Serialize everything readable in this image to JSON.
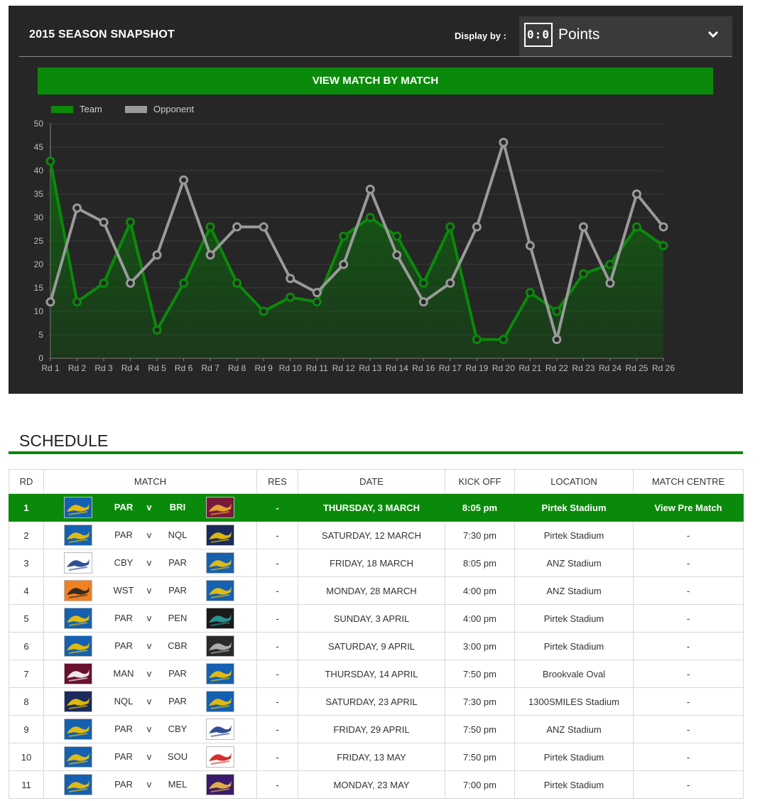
{
  "snapshot": {
    "title": "2015 SEASON SNAPSHOT",
    "display_label": "Display by :",
    "display_icon_text": "0:0",
    "display_value": "Points",
    "view_button": "VIEW MATCH BY MATCH"
  },
  "chart_data": {
    "type": "line",
    "categories": [
      "Rd 1",
      "Rd 2",
      "Rd 3",
      "Rd 4",
      "Rd 5",
      "Rd 6",
      "Rd 7",
      "Rd 8",
      "Rd 9",
      "Rd 10",
      "Rd 11",
      "Rd 12",
      "Rd 13",
      "Rd 14",
      "Rd 16",
      "Rd 17",
      "Rd 19",
      "Rd 20",
      "Rd 21",
      "Rd 22",
      "Rd 23",
      "Rd 24",
      "Rd 25",
      "Rd 26"
    ],
    "series": [
      {
        "name": "Team",
        "color": "#0a8a0a",
        "fill": "area",
        "values": [
          42,
          12,
          16,
          29,
          6,
          16,
          28,
          16,
          10,
          13,
          12,
          26,
          30,
          26,
          16,
          28,
          4,
          4,
          14,
          10,
          18,
          20,
          28,
          24
        ]
      },
      {
        "name": "Opponent",
        "color": "#9a9a9a",
        "values": [
          12,
          32,
          29,
          16,
          22,
          38,
          22,
          28,
          28,
          17,
          14,
          20,
          36,
          22,
          12,
          16,
          28,
          46,
          24,
          4,
          28,
          16,
          35,
          28
        ]
      }
    ],
    "ylim": [
      0,
      50
    ],
    "yticks": [
      0,
      5,
      10,
      15,
      20,
      25,
      30,
      35,
      40,
      45,
      50
    ],
    "grid": true,
    "legend": "top-left",
    "title": "",
    "xlabel": "",
    "ylabel": ""
  },
  "schedule": {
    "title": "SCHEDULE",
    "columns": [
      "RD",
      "MATCH",
      "RES",
      "DATE",
      "KICK OFF",
      "LOCATION",
      "MATCH CENTRE"
    ],
    "vs_label": "v",
    "rows": [
      {
        "rd": "1",
        "home": "PAR",
        "away": "BRI",
        "res": "-",
        "date": "THURSDAY, 3 MARCH",
        "kickoff": "8:05 pm",
        "location": "Pirtek Stadium",
        "centre": "View Pre Match",
        "highlight": true
      },
      {
        "rd": "2",
        "home": "PAR",
        "away": "NQL",
        "res": "-",
        "date": "SATURDAY, 12 MARCH",
        "kickoff": "7:30 pm",
        "location": "Pirtek Stadium",
        "centre": "-"
      },
      {
        "rd": "3",
        "home": "CBY",
        "away": "PAR",
        "res": "-",
        "date": "FRIDAY, 18 MARCH",
        "kickoff": "8:05 pm",
        "location": "ANZ Stadium",
        "centre": "-"
      },
      {
        "rd": "4",
        "home": "WST",
        "away": "PAR",
        "res": "-",
        "date": "MONDAY, 28 MARCH",
        "kickoff": "4:00 pm",
        "location": "ANZ Stadium",
        "centre": "-"
      },
      {
        "rd": "5",
        "home": "PAR",
        "away": "PEN",
        "res": "-",
        "date": "SUNDAY, 3 APRIL",
        "kickoff": "4:00 pm",
        "location": "Pirtek Stadium",
        "centre": "-"
      },
      {
        "rd": "6",
        "home": "PAR",
        "away": "CBR",
        "res": "-",
        "date": "SATURDAY, 9 APRIL",
        "kickoff": "3:00 pm",
        "location": "Pirtek Stadium",
        "centre": "-"
      },
      {
        "rd": "7",
        "home": "MAN",
        "away": "PAR",
        "res": "-",
        "date": "THURSDAY, 14 APRIL",
        "kickoff": "7:50 pm",
        "location": "Brookvale Oval",
        "centre": "-"
      },
      {
        "rd": "8",
        "home": "NQL",
        "away": "PAR",
        "res": "-",
        "date": "SATURDAY, 23 APRIL",
        "kickoff": "7:30 pm",
        "location": "1300SMILES Stadium",
        "centre": "-"
      },
      {
        "rd": "9",
        "home": "PAR",
        "away": "CBY",
        "res": "-",
        "date": "FRIDAY, 29 APRIL",
        "kickoff": "7:50 pm",
        "location": "ANZ Stadium",
        "centre": "-"
      },
      {
        "rd": "10",
        "home": "PAR",
        "away": "SOU",
        "res": "-",
        "date": "FRIDAY, 13 MAY",
        "kickoff": "7:50 pm",
        "location": "Pirtek Stadium",
        "centre": "-"
      },
      {
        "rd": "11",
        "home": "PAR",
        "away": "MEL",
        "res": "-",
        "date": "MONDAY, 23 MAY",
        "kickoff": "7:00 pm",
        "location": "Pirtek Stadium",
        "centre": "-"
      }
    ]
  },
  "team_logos": {
    "PAR": {
      "icon": "eels-logo-icon",
      "bg": "#1560b0",
      "fg": "#f5c400"
    },
    "BRI": {
      "icon": "broncos-logo-icon",
      "bg": "#7a1a3a",
      "fg": "#f0b030"
    },
    "NQL": {
      "icon": "cowboys-logo-icon",
      "bg": "#1a2a5a",
      "fg": "#f2c800"
    },
    "CBY": {
      "icon": "bulldogs-logo-icon",
      "bg": "#ffffff",
      "fg": "#1a3c8a"
    },
    "WST": {
      "icon": "tigers-logo-icon",
      "bg": "#f08020",
      "fg": "#222222"
    },
    "PEN": {
      "icon": "panthers-logo-icon",
      "bg": "#1a1a1a",
      "fg": "#2aa0a0"
    },
    "CBR": {
      "icon": "raiders-logo-icon",
      "bg": "#2a2a2a",
      "fg": "#bbbbbb"
    },
    "MAN": {
      "icon": "sea-eagles-logo-icon",
      "bg": "#6a1030",
      "fg": "#ffffff"
    },
    "SOU": {
      "icon": "rabbitohs-logo-icon",
      "bg": "#ffffff",
      "fg": "#d01818"
    },
    "MEL": {
      "icon": "storm-logo-icon",
      "bg": "#3a1a6a",
      "fg": "#f0c040"
    }
  }
}
